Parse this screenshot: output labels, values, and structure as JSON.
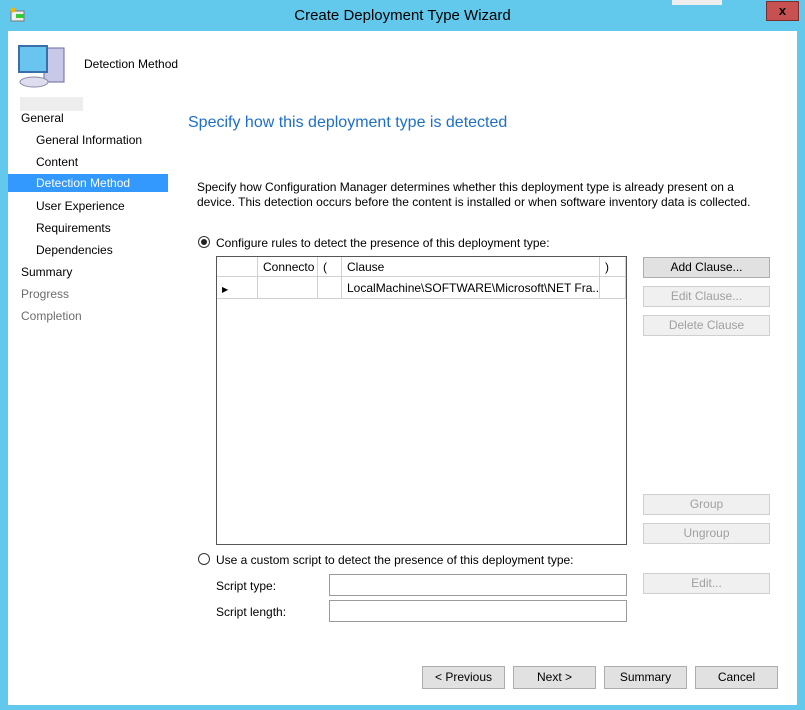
{
  "window": {
    "title": "Create Deployment Type Wizard",
    "close_glyph": "x"
  },
  "header": {
    "page": "Detection Method"
  },
  "sidebar": {
    "items": [
      {
        "label": "General",
        "level": 0,
        "state": "normal"
      },
      {
        "label": "General Information",
        "level": 1,
        "state": "normal"
      },
      {
        "label": "Content",
        "level": 1,
        "state": "normal"
      },
      {
        "label": "Detection Method",
        "level": 1,
        "state": "selected"
      },
      {
        "label": "User Experience",
        "level": 1,
        "state": "normal"
      },
      {
        "label": "Requirements",
        "level": 1,
        "state": "normal"
      },
      {
        "label": "Dependencies",
        "level": 1,
        "state": "normal"
      },
      {
        "label": "Summary",
        "level": 0,
        "state": "normal"
      },
      {
        "label": "Progress",
        "level": 0,
        "state": "disabled"
      },
      {
        "label": "Completion",
        "level": 0,
        "state": "disabled"
      }
    ]
  },
  "main": {
    "heading": "Specify how this deployment type is detected",
    "description": "Specify how Configuration Manager determines whether this deployment type is already present on a device. This detection occurs before the content is installed or when software inventory data is collected.",
    "option_rules": {
      "label": "Configure rules to detect the presence of this deployment type:",
      "selected": true
    },
    "grid": {
      "columns": [
        "",
        "Connecto",
        "(",
        "Clause",
        ")"
      ],
      "rows": [
        [
          "",
          "",
          "",
          "LocalMachine\\SOFTWARE\\Microsoft\\NET Fra...",
          ""
        ]
      ]
    },
    "buttons": {
      "add_clause": "Add Clause...",
      "edit_clause": "Edit Clause...",
      "delete_clause": "Delete Clause",
      "group": "Group",
      "ungroup": "Ungroup",
      "edit": "Edit..."
    },
    "option_script": {
      "label": "Use a custom script to detect the presence of this deployment type:",
      "selected": false
    },
    "script_type_label": "Script type:",
    "script_type_value": "",
    "script_length_label": "Script length:",
    "script_length_value": ""
  },
  "footer": {
    "previous": "< Previous",
    "next": "Next >",
    "summary": "Summary",
    "cancel": "Cancel"
  },
  "colors": {
    "titlebar": "#63c9ec",
    "selection": "#3399ff",
    "heading": "#1e6fc8",
    "close": "#c75050"
  }
}
